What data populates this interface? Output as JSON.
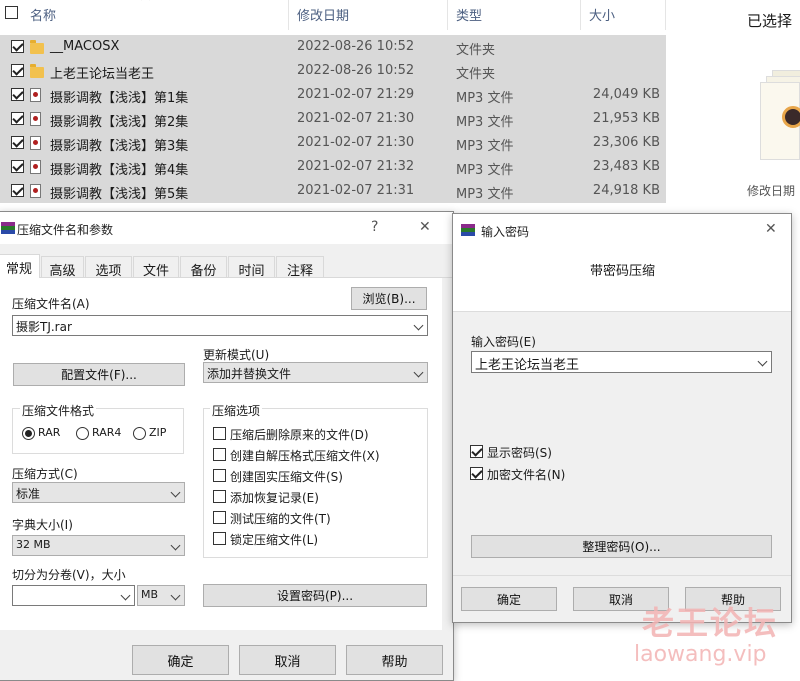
{
  "explorer": {
    "columns": {
      "name": "名称",
      "modified": "修改日期",
      "type": "类型",
      "size": "大小"
    },
    "rows": [
      {
        "name": "__MACOSX",
        "modified": "2022-08-26 10:52",
        "type": "文件夹",
        "size": "",
        "icon": "folder-icon"
      },
      {
        "name": "上老王论坛当老王",
        "modified": "2022-08-26 10:52",
        "type": "文件夹",
        "size": "",
        "icon": "folder-icon"
      },
      {
        "name": "摄影调教【浅浅】第1集",
        "modified": "2021-02-07 21:29",
        "type": "MP3 文件",
        "size": "24,049 KB",
        "icon": "mp3-file-icon"
      },
      {
        "name": "摄影调教【浅浅】第2集",
        "modified": "2021-02-07 21:30",
        "type": "MP3 文件",
        "size": "21,953 KB",
        "icon": "mp3-file-icon"
      },
      {
        "name": "摄影调教【浅浅】第3集",
        "modified": "2021-02-07 21:30",
        "type": "MP3 文件",
        "size": "23,306 KB",
        "icon": "mp3-file-icon"
      },
      {
        "name": "摄影调教【浅浅】第4集",
        "modified": "2021-02-07 21:32",
        "type": "MP3 文件",
        "size": "23,483 KB",
        "icon": "mp3-file-icon"
      },
      {
        "name": "摄影调教【浅浅】第5集",
        "modified": "2021-02-07 21:31",
        "type": "MP3 文件",
        "size": "24,918 KB",
        "icon": "mp3-file-icon"
      }
    ],
    "preview": {
      "title": "已选择",
      "modified_label": "修改日期"
    }
  },
  "archive_dialog": {
    "title": "压缩文件名和参数",
    "help_glyph": "?",
    "close_glyph": "✕",
    "tabs": [
      "常规",
      "高级",
      "选项",
      "文件",
      "备份",
      "时间",
      "注释"
    ],
    "archive_name_label": "压缩文件名(A)",
    "browse_button": "浏览(B)...",
    "archive_name_value": "摄影TJ.rar",
    "update_mode_label": "更新模式(U)",
    "update_mode_value": "添加并替换文件",
    "profiles_button": "配置文件(F)...",
    "format_label": "压缩文件格式",
    "formats": [
      "RAR",
      "RAR4",
      "ZIP"
    ],
    "selected_format": "RAR",
    "options_label": "压缩选项",
    "options": [
      {
        "label": "压缩后删除原来的文件(D)",
        "checked": false
      },
      {
        "label": "创建自解压格式压缩文件(X)",
        "checked": false
      },
      {
        "label": "创建固实压缩文件(S)",
        "checked": false
      },
      {
        "label": "添加恢复记录(E)",
        "checked": false
      },
      {
        "label": "测试压缩的文件(T)",
        "checked": false
      },
      {
        "label": "锁定压缩文件(L)",
        "checked": false
      }
    ],
    "method_label": "压缩方式(C)",
    "method_value": "标准",
    "dict_label": "字典大小(I)",
    "dict_value": "32 MB",
    "split_label": "切分为分卷(V)，大小",
    "split_value": "",
    "split_unit": "MB",
    "set_password_button": "设置密码(P)...",
    "ok_button": "确定",
    "cancel_button": "取消",
    "help_button": "帮助"
  },
  "password_dialog": {
    "title": "输入密码",
    "close_glyph": "✕",
    "heading": "带密码压缩",
    "password_label": "输入密码(E)",
    "password_value": "上老王论坛当老王",
    "show_password_label": "显示密码(S)",
    "show_password_checked": true,
    "encrypt_names_label": "加密文件名(N)",
    "encrypt_names_checked": true,
    "organize_button": "整理密码(O)...",
    "ok_button": "确定",
    "cancel_button": "取消",
    "help_button": "帮助"
  },
  "watermark": {
    "text_cn": "老王论坛",
    "text_en": "laowang.vip"
  },
  "colors": {
    "selection": "#d9d9d9",
    "dialog_bg": "#f0f0f0",
    "watermark": "#f3b3b3",
    "header_text": "#4d6082"
  }
}
